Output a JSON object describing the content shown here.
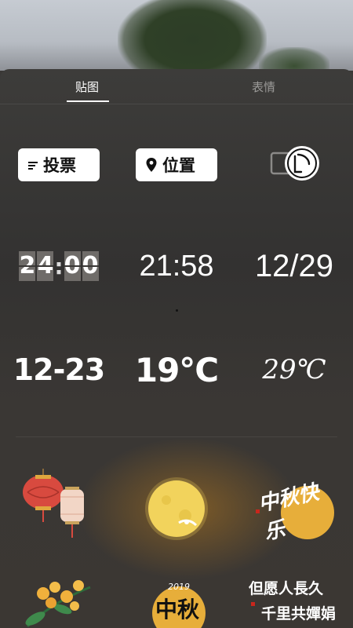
{
  "tabs": [
    {
      "label": "贴图",
      "active": true
    },
    {
      "label": "表情",
      "active": false
    }
  ],
  "stickers": {
    "vote_label": "投票",
    "location_label": "位置",
    "flip_clock": {
      "digits": [
        "2",
        "4",
        "0",
        "0"
      ]
    },
    "time_text": "21:58",
    "date_slash": "12/29",
    "date_dash": "12-23",
    "temp_bold": "19°C",
    "temp_script": "29℃",
    "midautumn_happy": "中秋快乐",
    "midautumn_2019_year": "2019",
    "midautumn_2019_text": "中秋",
    "poem_line1": "但愿人長久",
    "poem_line2": "千里共嬋娟"
  },
  "colors": {
    "accent_white": "#ffffff",
    "moon": "#f2d35c",
    "lantern_red": "#d84a3f",
    "stamp_red": "#c8261c"
  }
}
